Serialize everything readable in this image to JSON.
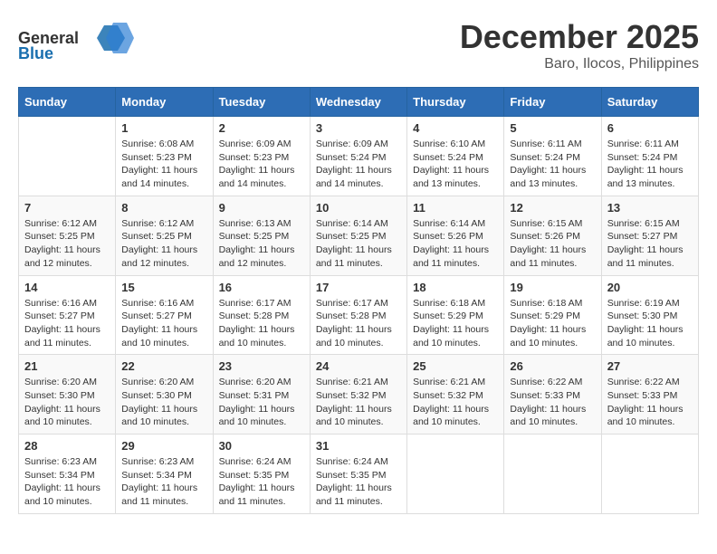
{
  "header": {
    "logo_general": "General",
    "logo_blue": "Blue",
    "month_title": "December 2025",
    "location": "Baro, Ilocos, Philippines"
  },
  "weekdays": [
    "Sunday",
    "Monday",
    "Tuesday",
    "Wednesday",
    "Thursday",
    "Friday",
    "Saturday"
  ],
  "weeks": [
    [
      {
        "day": "",
        "sunrise": "",
        "sunset": "",
        "daylight": ""
      },
      {
        "day": "1",
        "sunrise": "Sunrise: 6:08 AM",
        "sunset": "Sunset: 5:23 PM",
        "daylight": "Daylight: 11 hours and 14 minutes."
      },
      {
        "day": "2",
        "sunrise": "Sunrise: 6:09 AM",
        "sunset": "Sunset: 5:23 PM",
        "daylight": "Daylight: 11 hours and 14 minutes."
      },
      {
        "day": "3",
        "sunrise": "Sunrise: 6:09 AM",
        "sunset": "Sunset: 5:24 PM",
        "daylight": "Daylight: 11 hours and 14 minutes."
      },
      {
        "day": "4",
        "sunrise": "Sunrise: 6:10 AM",
        "sunset": "Sunset: 5:24 PM",
        "daylight": "Daylight: 11 hours and 13 minutes."
      },
      {
        "day": "5",
        "sunrise": "Sunrise: 6:11 AM",
        "sunset": "Sunset: 5:24 PM",
        "daylight": "Daylight: 11 hours and 13 minutes."
      },
      {
        "day": "6",
        "sunrise": "Sunrise: 6:11 AM",
        "sunset": "Sunset: 5:24 PM",
        "daylight": "Daylight: 11 hours and 13 minutes."
      }
    ],
    [
      {
        "day": "7",
        "sunrise": "Sunrise: 6:12 AM",
        "sunset": "Sunset: 5:25 PM",
        "daylight": "Daylight: 11 hours and 12 minutes."
      },
      {
        "day": "8",
        "sunrise": "Sunrise: 6:12 AM",
        "sunset": "Sunset: 5:25 PM",
        "daylight": "Daylight: 11 hours and 12 minutes."
      },
      {
        "day": "9",
        "sunrise": "Sunrise: 6:13 AM",
        "sunset": "Sunset: 5:25 PM",
        "daylight": "Daylight: 11 hours and 12 minutes."
      },
      {
        "day": "10",
        "sunrise": "Sunrise: 6:14 AM",
        "sunset": "Sunset: 5:25 PM",
        "daylight": "Daylight: 11 hours and 11 minutes."
      },
      {
        "day": "11",
        "sunrise": "Sunrise: 6:14 AM",
        "sunset": "Sunset: 5:26 PM",
        "daylight": "Daylight: 11 hours and 11 minutes."
      },
      {
        "day": "12",
        "sunrise": "Sunrise: 6:15 AM",
        "sunset": "Sunset: 5:26 PM",
        "daylight": "Daylight: 11 hours and 11 minutes."
      },
      {
        "day": "13",
        "sunrise": "Sunrise: 6:15 AM",
        "sunset": "Sunset: 5:27 PM",
        "daylight": "Daylight: 11 hours and 11 minutes."
      }
    ],
    [
      {
        "day": "14",
        "sunrise": "Sunrise: 6:16 AM",
        "sunset": "Sunset: 5:27 PM",
        "daylight": "Daylight: 11 hours and 11 minutes."
      },
      {
        "day": "15",
        "sunrise": "Sunrise: 6:16 AM",
        "sunset": "Sunset: 5:27 PM",
        "daylight": "Daylight: 11 hours and 10 minutes."
      },
      {
        "day": "16",
        "sunrise": "Sunrise: 6:17 AM",
        "sunset": "Sunset: 5:28 PM",
        "daylight": "Daylight: 11 hours and 10 minutes."
      },
      {
        "day": "17",
        "sunrise": "Sunrise: 6:17 AM",
        "sunset": "Sunset: 5:28 PM",
        "daylight": "Daylight: 11 hours and 10 minutes."
      },
      {
        "day": "18",
        "sunrise": "Sunrise: 6:18 AM",
        "sunset": "Sunset: 5:29 PM",
        "daylight": "Daylight: 11 hours and 10 minutes."
      },
      {
        "day": "19",
        "sunrise": "Sunrise: 6:18 AM",
        "sunset": "Sunset: 5:29 PM",
        "daylight": "Daylight: 11 hours and 10 minutes."
      },
      {
        "day": "20",
        "sunrise": "Sunrise: 6:19 AM",
        "sunset": "Sunset: 5:30 PM",
        "daylight": "Daylight: 11 hours and 10 minutes."
      }
    ],
    [
      {
        "day": "21",
        "sunrise": "Sunrise: 6:20 AM",
        "sunset": "Sunset: 5:30 PM",
        "daylight": "Daylight: 11 hours and 10 minutes."
      },
      {
        "day": "22",
        "sunrise": "Sunrise: 6:20 AM",
        "sunset": "Sunset: 5:30 PM",
        "daylight": "Daylight: 11 hours and 10 minutes."
      },
      {
        "day": "23",
        "sunrise": "Sunrise: 6:20 AM",
        "sunset": "Sunset: 5:31 PM",
        "daylight": "Daylight: 11 hours and 10 minutes."
      },
      {
        "day": "24",
        "sunrise": "Sunrise: 6:21 AM",
        "sunset": "Sunset: 5:32 PM",
        "daylight": "Daylight: 11 hours and 10 minutes."
      },
      {
        "day": "25",
        "sunrise": "Sunrise: 6:21 AM",
        "sunset": "Sunset: 5:32 PM",
        "daylight": "Daylight: 11 hours and 10 minutes."
      },
      {
        "day": "26",
        "sunrise": "Sunrise: 6:22 AM",
        "sunset": "Sunset: 5:33 PM",
        "daylight": "Daylight: 11 hours and 10 minutes."
      },
      {
        "day": "27",
        "sunrise": "Sunrise: 6:22 AM",
        "sunset": "Sunset: 5:33 PM",
        "daylight": "Daylight: 11 hours and 10 minutes."
      }
    ],
    [
      {
        "day": "28",
        "sunrise": "Sunrise: 6:23 AM",
        "sunset": "Sunset: 5:34 PM",
        "daylight": "Daylight: 11 hours and 10 minutes."
      },
      {
        "day": "29",
        "sunrise": "Sunrise: 6:23 AM",
        "sunset": "Sunset: 5:34 PM",
        "daylight": "Daylight: 11 hours and 11 minutes."
      },
      {
        "day": "30",
        "sunrise": "Sunrise: 6:24 AM",
        "sunset": "Sunset: 5:35 PM",
        "daylight": "Daylight: 11 hours and 11 minutes."
      },
      {
        "day": "31",
        "sunrise": "Sunrise: 6:24 AM",
        "sunset": "Sunset: 5:35 PM",
        "daylight": "Daylight: 11 hours and 11 minutes."
      },
      {
        "day": "",
        "sunrise": "",
        "sunset": "",
        "daylight": ""
      },
      {
        "day": "",
        "sunrise": "",
        "sunset": "",
        "daylight": ""
      },
      {
        "day": "",
        "sunrise": "",
        "sunset": "",
        "daylight": ""
      }
    ]
  ]
}
